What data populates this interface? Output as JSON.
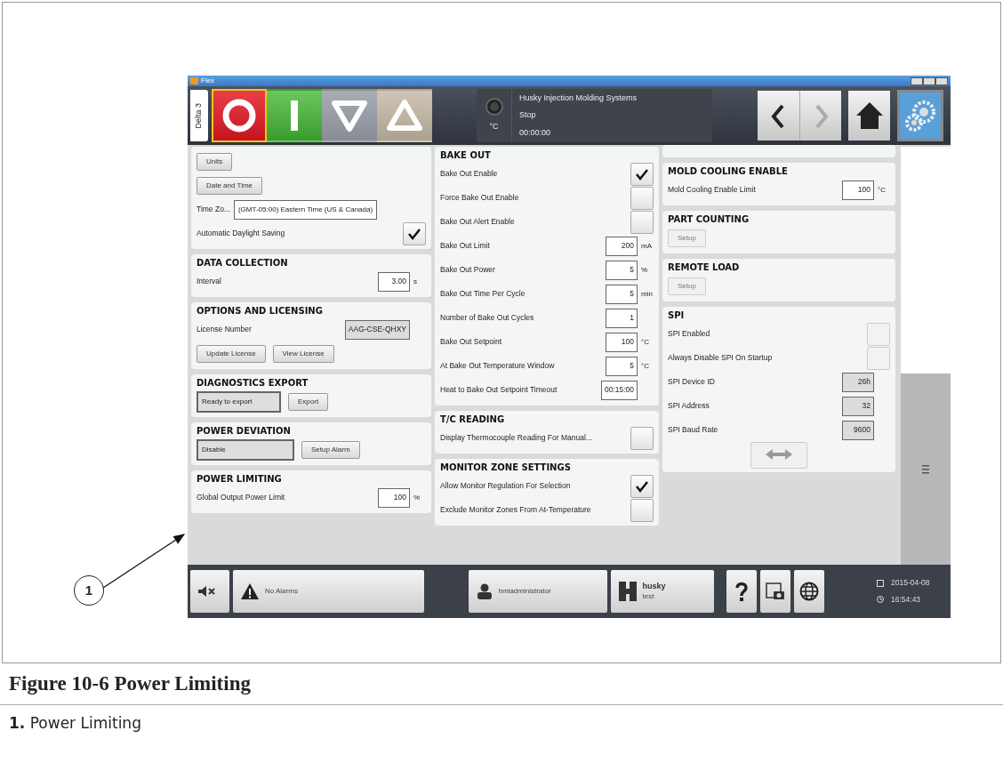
{
  "window": {
    "title": "Flex"
  },
  "header": {
    "side_tab": "Delta 3",
    "mode_buttons": [
      {
        "kind": "stop",
        "selected": true
      },
      {
        "kind": "on",
        "selected": false
      },
      {
        "kind": "down",
        "selected": false
      },
      {
        "kind": "up",
        "selected": false
      }
    ],
    "status": {
      "company": "Husky Injection Molding Systems",
      "state": "Stop",
      "unit": "°C",
      "time": "00:00:00"
    },
    "nav": [
      {
        "kind": "back",
        "disabled": false,
        "selected": false
      },
      {
        "kind": "forward",
        "disabled": true,
        "selected": false
      },
      {
        "kind": "home",
        "disabled": false,
        "selected": false
      },
      {
        "kind": "settings",
        "disabled": false,
        "selected": true
      }
    ]
  },
  "columns": [
    {
      "sections": [
        {
          "rows": [
            {
              "kind": "button",
              "label": "Units",
              "disabled": false
            },
            {
              "kind": "button",
              "label": "Date and Time",
              "disabled": false
            },
            {
              "kind": "combo",
              "label": "Time Zo...",
              "value": "(GMT-05:00) Eastern Time (US & Canada)"
            },
            {
              "kind": "checkbox",
              "label": "Automatic Daylight Saving",
              "checked": true,
              "disabled": false
            }
          ]
        },
        {
          "title": "DATA COLLECTION",
          "rows": [
            {
              "kind": "field",
              "label": "Interval",
              "value": "3.00",
              "unit": "s",
              "readonly": false
            }
          ]
        },
        {
          "title": "OPTIONS AND LICENSING",
          "rows": [
            {
              "kind": "field",
              "label": "License Number",
              "value": "AAG-CSE-QHXY",
              "readonly": true
            },
            {
              "kind": "buttons",
              "buttons": [
                {
                  "label": "Update License",
                  "disabled": false
                },
                {
                  "label": "View License",
                  "disabled": false
                }
              ]
            }
          ]
        },
        {
          "title": "DIAGNOSTICS EXPORT",
          "rows": [
            {
              "kind": "status",
              "value": "Ready to export",
              "button": "Export"
            }
          ]
        },
        {
          "title": "POWER DEVIATION",
          "rows": [
            {
              "kind": "status",
              "value": "Disable",
              "button": "Setup Alarm"
            }
          ]
        },
        {
          "title": "POWER LIMITING",
          "rows": [
            {
              "kind": "field",
              "label": "Global Output Power Limit",
              "value": "100",
              "unit": "%",
              "readonly": false
            }
          ]
        }
      ]
    },
    {
      "sections": [
        {
          "title": "BAKE OUT",
          "rows": [
            {
              "kind": "checkbox",
              "label": "Bake Out Enable",
              "checked": true,
              "disabled": false
            },
            {
              "kind": "checkbox",
              "label": "Force Bake Out Enable",
              "checked": false,
              "disabled": false
            },
            {
              "kind": "checkbox",
              "label": "Bake Out Alert Enable",
              "checked": false,
              "disabled": false
            },
            {
              "kind": "field",
              "label": "Bake Out Limit",
              "value": "200",
              "unit": "mA",
              "readonly": false
            },
            {
              "kind": "field",
              "label": "Bake Out Power",
              "value": "5",
              "unit": "%",
              "readonly": false
            },
            {
              "kind": "field",
              "label": "Bake Out Time Per Cycle",
              "value": "5",
              "unit": "min",
              "readonly": false
            },
            {
              "kind": "field",
              "label": "Number of Bake Out Cycles",
              "value": "1",
              "readonly": false
            },
            {
              "kind": "field",
              "label": "Bake Out Setpoint",
              "value": "100",
              "unit": "°C",
              "readonly": false
            },
            {
              "kind": "field",
              "label": "At Bake Out Temperature Window",
              "value": "5",
              "unit": "°C",
              "readonly": false
            },
            {
              "kind": "field",
              "label": "Heat to Bake Out Setpoint Timeout",
              "value": "00:15:00",
              "readonly": false
            }
          ]
        },
        {
          "title": "T/C READING",
          "rows": [
            {
              "kind": "checkbox",
              "label": "Display Thermocouple Reading For Manual...",
              "checked": false,
              "disabled": false
            }
          ]
        },
        {
          "title": "MONITOR ZONE SETTINGS",
          "rows": [
            {
              "kind": "checkbox",
              "label": "Allow Monitor Regulation For Selection",
              "checked": true,
              "disabled": false
            },
            {
              "kind": "checkbox",
              "label": "Exclude Monitor Zones From At-Temperature",
              "checked": false,
              "disabled": false
            }
          ]
        }
      ]
    },
    {
      "sections": [
        {
          "title": "MOLD COOLING ENABLE",
          "rows": [
            {
              "kind": "field",
              "label": "Mold Cooling Enable Limit",
              "value": "100",
              "unit": "°C",
              "readonly": false
            }
          ]
        },
        {
          "title": "PART COUNTING",
          "rows": [
            {
              "kind": "button",
              "label": "Setup",
              "disabled": true
            }
          ]
        },
        {
          "title": "REMOTE LOAD",
          "rows": [
            {
              "kind": "button",
              "label": "Setup",
              "disabled": true
            }
          ]
        },
        {
          "title": "SPI",
          "rows": [
            {
              "kind": "checkbox",
              "label": "SPI Enabled",
              "checked": false,
              "disabled": true
            },
            {
              "kind": "checkbox",
              "label": "Always Disable SPI On Startup",
              "checked": false,
              "disabled": true
            },
            {
              "kind": "field",
              "label": "SPI Device ID",
              "value": "26h",
              "readonly": true
            },
            {
              "kind": "field",
              "label": "SPI Address",
              "value": "32",
              "readonly": true
            },
            {
              "kind": "field",
              "label": "SPI Baud Rate",
              "value": "9600",
              "readonly": true
            },
            {
              "kind": "icon_button",
              "disabled": true
            }
          ]
        }
      ]
    }
  ],
  "bottom_bar": {
    "alarm": "No Alarms",
    "user": "hmiadministrator",
    "machine": "husky",
    "machine_sub": "test",
    "date": "2015-04-08",
    "time": "16:54:43"
  },
  "callout": "1",
  "caption": "Figure 10-6 Power Limiting",
  "legend": [
    {
      "number": "1.",
      "text": "Power Limiting"
    }
  ]
}
